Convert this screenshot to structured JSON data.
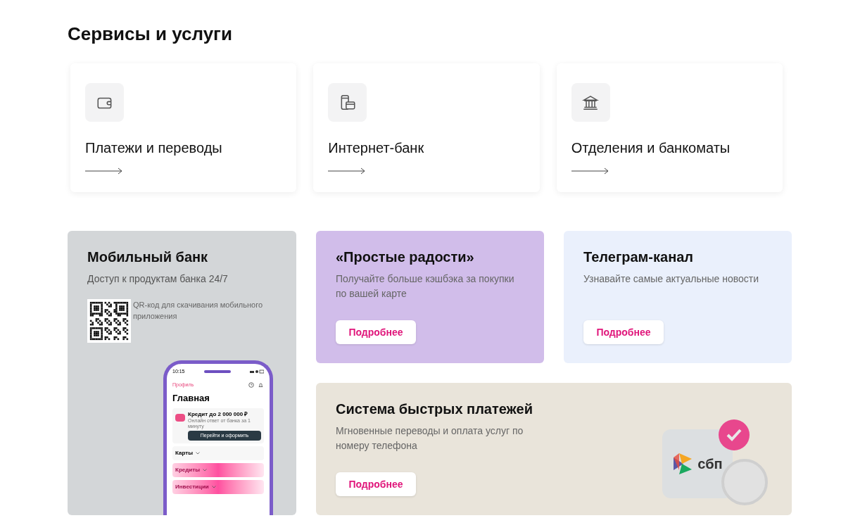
{
  "title": "Сервисы и услуги",
  "services": [
    {
      "kind": "wallet",
      "label": "Платежи и переводы"
    },
    {
      "kind": "phone-card",
      "label": "Интернет-банк"
    },
    {
      "kind": "bank",
      "label": "Отделения и банкоматы"
    }
  ],
  "mobile_bank": {
    "title": "Мобильный банк",
    "subtitle": "Доступ к продуктам банка 24/7",
    "qr_caption": "QR-код для скачивания мобильного приложения",
    "phone": {
      "time": "10:15",
      "profile": "Профиль",
      "heading": "Главная",
      "offer_title": "Кредит до 2 000 000 ₽",
      "offer_text": "Онлайн ответ от банка за 1 минуту",
      "offer_button": "Перейти и оформить",
      "sections": [
        {
          "label": "Карты",
          "highlighted": false
        },
        {
          "label": "Кредиты",
          "highlighted": true
        },
        {
          "label": "Инвестиции",
          "highlighted": true
        }
      ]
    }
  },
  "promos": [
    {
      "kind": "joys",
      "title": "«Простые радости»",
      "text": "Получайте больше кэшбэка за покупки по вашей карте",
      "button": "Подробнее"
    },
    {
      "kind": "telegram",
      "title": "Телеграм-канал",
      "text": "Узнавайте самые актуальные новости",
      "button": "Подробнее"
    }
  ],
  "sbp": {
    "title": "Система быстрых платежей",
    "text": "Мгновенные переводы и оплата услуг по номеру телефона",
    "button": "Подробнее",
    "logo_text": "сбп"
  }
}
